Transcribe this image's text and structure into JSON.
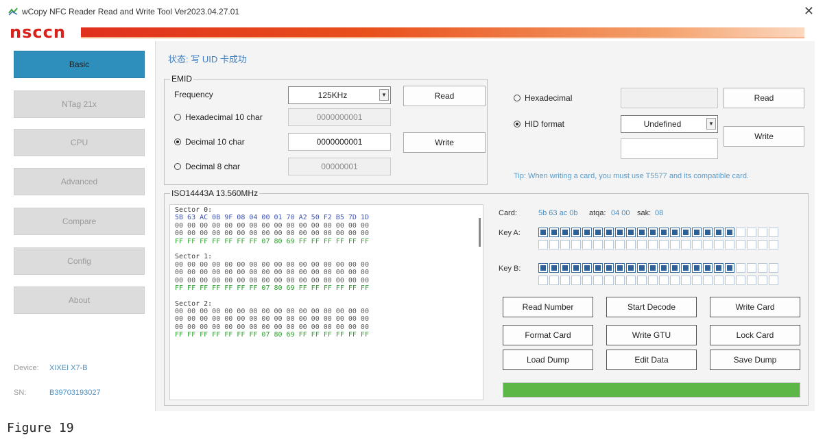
{
  "window": {
    "title": "wCopy NFC Reader Read and Write Tool  Ver2023.04.27.01",
    "close_glyph": "✕",
    "brand_text": "nsccn"
  },
  "sidebar": {
    "items": [
      {
        "label": "Basic",
        "active": true
      },
      {
        "label": "NTag 21x",
        "active": false
      },
      {
        "label": "CPU",
        "active": false
      },
      {
        "label": "Advanced",
        "active": false
      },
      {
        "label": "Compare",
        "active": false
      },
      {
        "label": "Config",
        "active": false
      },
      {
        "label": "About",
        "active": false
      }
    ],
    "device_label": "Device:",
    "device_value": "XIXEI X7-B",
    "sn_label": "SN:",
    "sn_value": "B39703193027"
  },
  "status": "状态: 写 UID 卡成功",
  "emid": {
    "title": "EMID",
    "frequency_label": "Frequency",
    "frequency_value": "125KHz",
    "read_button": "Read",
    "write_button": "Write",
    "hex10_label": "Hexadecimal 10 char",
    "hex10_value": "0000000001",
    "dec10_label": "Decimal 10 char",
    "dec10_value": "0000000001",
    "dec8_label": "Decimal 8 char",
    "dec8_value": "00000001",
    "selected": "dec10"
  },
  "hid": {
    "hex_label": "Hexadecimal",
    "hex_value": "",
    "hid_label": "HID format",
    "hid_format_value": "Undefined",
    "hid_value": "",
    "read_button": "Read",
    "write_button": "Write",
    "selected": "hid"
  },
  "tip": "Tip: When writing a card, you must use T5577 and its compatible card.",
  "iso": {
    "title": "ISO14443A 13.560MHz",
    "dump_lines": [
      {
        "text": "Sector 0:",
        "kind": "hdr"
      },
      {
        "text": "5B 63 AC 0B 9F 08 04 00 01 70 A2 50 F2 B5 7D 1D",
        "kind": "uid"
      },
      {
        "text": "00 00 00 00 00 00 00 00 00 00 00 00 00 00 00 00",
        "kind": "data"
      },
      {
        "text": "00 00 00 00 00 00 00 00 00 00 00 00 00 00 00 00",
        "kind": "data"
      },
      {
        "text": "FF FF FF FF FF FF FF 07 80 69 FF FF FF FF FF FF",
        "kind": "trailer"
      },
      {
        "text": "",
        "kind": "data"
      },
      {
        "text": "Sector 1:",
        "kind": "hdr"
      },
      {
        "text": "00 00 00 00 00 00 00 00 00 00 00 00 00 00 00 00",
        "kind": "data"
      },
      {
        "text": "00 00 00 00 00 00 00 00 00 00 00 00 00 00 00 00",
        "kind": "data"
      },
      {
        "text": "00 00 00 00 00 00 00 00 00 00 00 00 00 00 00 00",
        "kind": "data"
      },
      {
        "text": "FF FF FF FF FF FF FF 07 80 69 FF FF FF FF FF FF",
        "kind": "trailer"
      },
      {
        "text": "",
        "kind": "data"
      },
      {
        "text": "Sector 2:",
        "kind": "hdr"
      },
      {
        "text": "00 00 00 00 00 00 00 00 00 00 00 00 00 00 00 00",
        "kind": "data"
      },
      {
        "text": "00 00 00 00 00 00 00 00 00 00 00 00 00 00 00 00",
        "kind": "data"
      },
      {
        "text": "00 00 00 00 00 00 00 00 00 00 00 00 00 00 00 00",
        "kind": "data"
      },
      {
        "text": "FF FF FF FF FF FF FF 07 80 69 FF FF FF FF FF FF",
        "kind": "trailer"
      }
    ],
    "card_label": "Card:",
    "card_value": "5b 63 ac 0b",
    "atqa_label": "atqa:",
    "atqa_value": "04 00",
    "sak_label": "sak:",
    "sak_value": "08",
    "key_a_label": "Key A:",
    "key_b_label": "Key B:",
    "key_a_filled": 18,
    "key_b_filled": 18,
    "key_slots_per_row": 22,
    "buttons": [
      "Read Number",
      "Start Decode",
      "Write Card",
      "Format Card",
      "Write GTU",
      "Lock Card",
      "Load Dump",
      "Edit Data",
      "Save Dump"
    ],
    "progress_fraction": 1.0
  },
  "caption": "Figure 19",
  "colors": {
    "accent_blue": "#2e8fbd",
    "brand_red": "#d8231d",
    "progress_green": "#5cb747",
    "uid_blue": "#3a4fb0",
    "trailer_green": "#2f9a2f"
  }
}
